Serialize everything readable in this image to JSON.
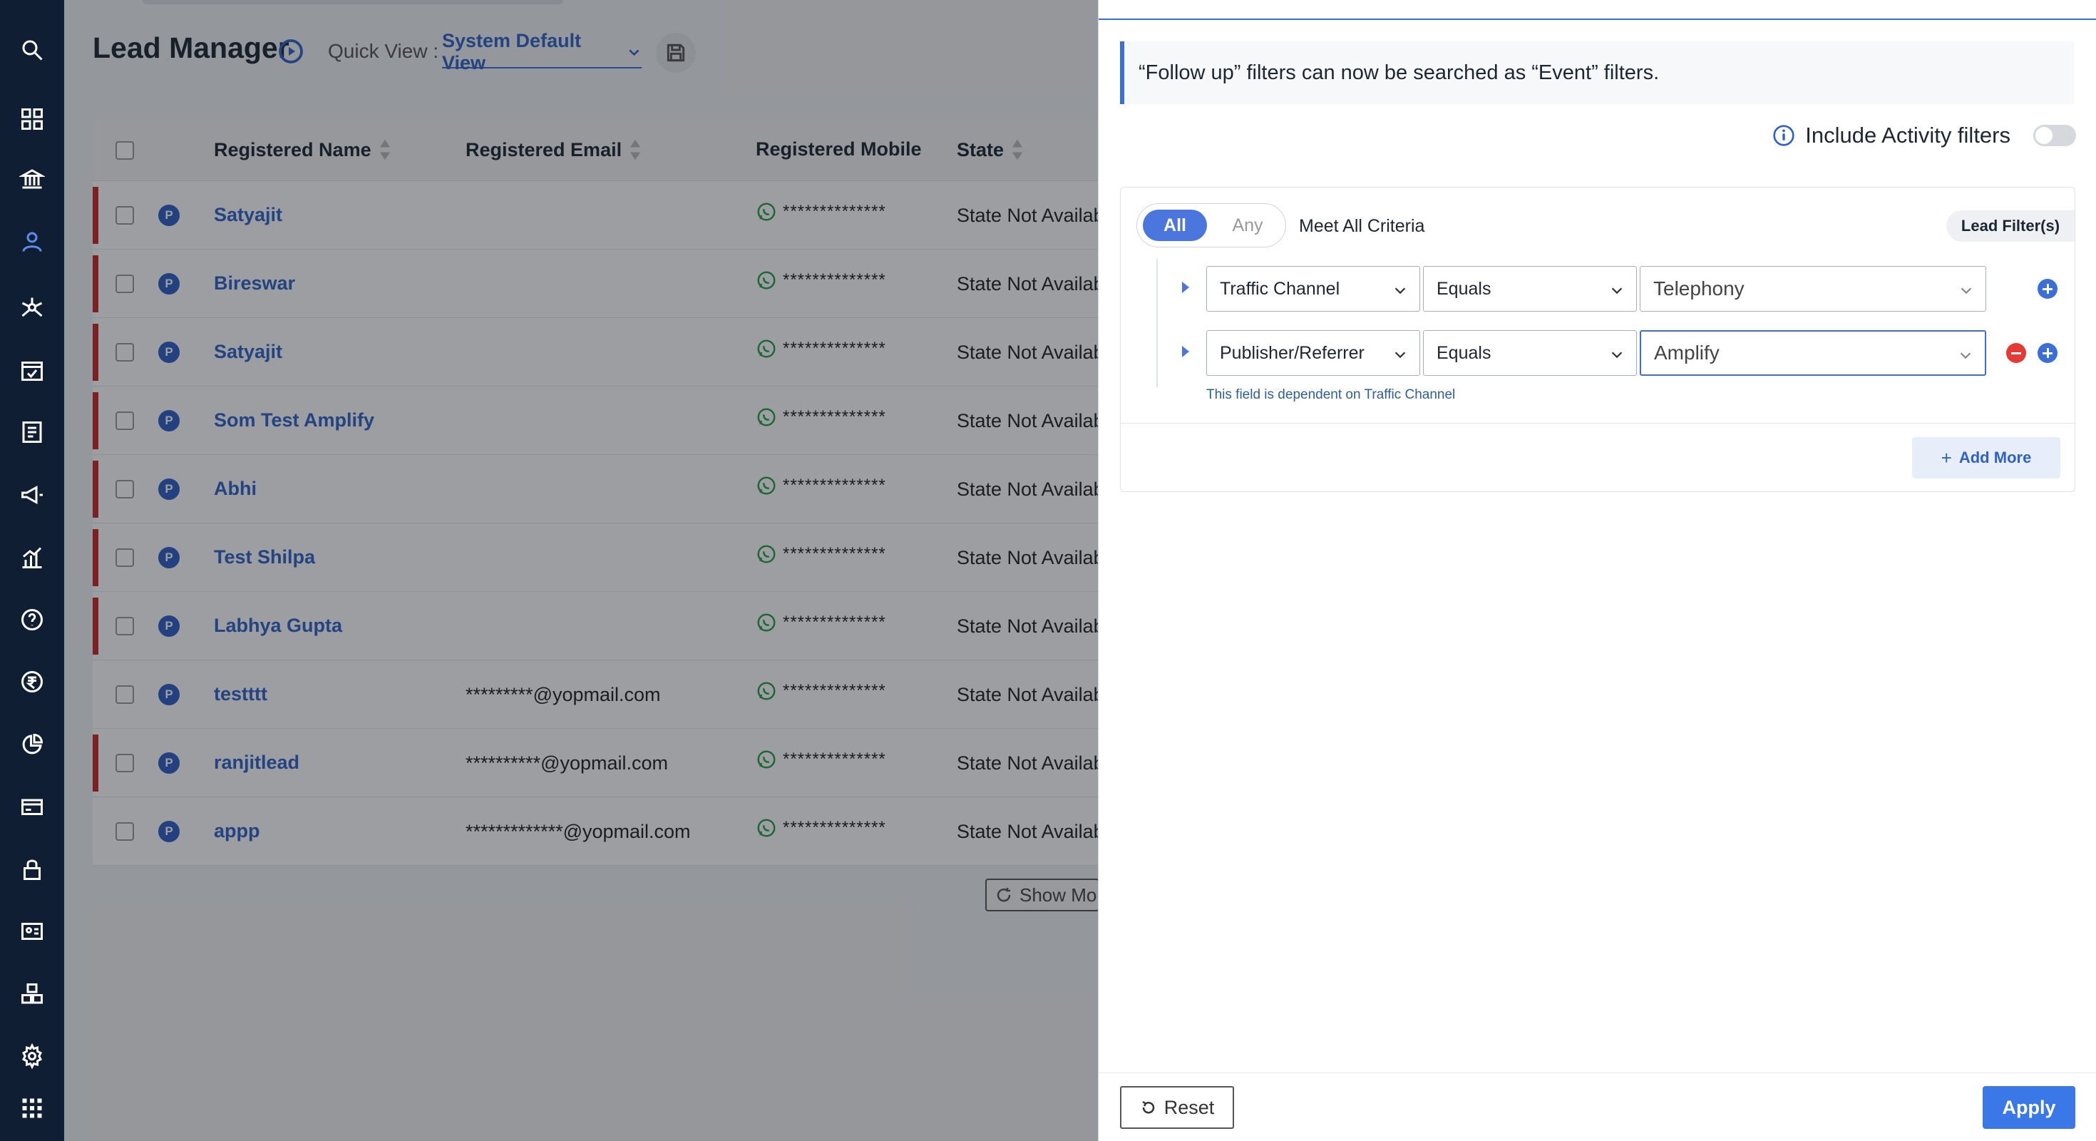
{
  "nav": {
    "icons": [
      "search-icon",
      "dashboard-icon",
      "bank-icon",
      "user-icon",
      "network-icon",
      "calendar-check-icon",
      "report-icon",
      "megaphone-icon",
      "analytics-icon",
      "help-icon",
      "rupee-icon",
      "pie-chart-icon",
      "card-icon",
      "lock-icon",
      "id-card-icon",
      "cubes-icon",
      "gear-icon",
      "apps-grid-icon"
    ],
    "active": "user-icon"
  },
  "header": {
    "title": "Lead Manager",
    "quick_view_label": "Quick View :",
    "quick_view_value": "System Default View"
  },
  "table": {
    "columns": [
      "Registered Name",
      "Registered Email",
      "Registered Mobile",
      "State"
    ],
    "rows": [
      {
        "name": "Satyajit",
        "email": "",
        "mobile": "**************",
        "state": "State Not Availab",
        "flagged": true
      },
      {
        "name": "Bireswar",
        "email": "",
        "mobile": "**************",
        "state": "State Not Availab",
        "flagged": true
      },
      {
        "name": "Satyajit",
        "email": "",
        "mobile": "**************",
        "state": "State Not Availab",
        "flagged": true
      },
      {
        "name": "Som Test Amplify",
        "email": "",
        "mobile": "**************",
        "state": "State Not Availab",
        "flagged": true
      },
      {
        "name": "Abhi",
        "email": "",
        "mobile": "**************",
        "state": "State Not Availab",
        "flagged": true
      },
      {
        "name": "Test Shilpa",
        "email": "",
        "mobile": "**************",
        "state": "State Not Availab",
        "flagged": true
      },
      {
        "name": "Labhya Gupta",
        "email": "",
        "mobile": "**************",
        "state": "State Not Availab",
        "flagged": true
      },
      {
        "name": "testttt",
        "email": "*********@yopmail.com",
        "mobile": "**************",
        "state": "State Not Availab",
        "flagged": false
      },
      {
        "name": "ranjitlead",
        "email": "**********@yopmail.com",
        "mobile": "**************",
        "state": "State Not Availab",
        "flagged": true
      },
      {
        "name": "appp",
        "email": "*************@yopmail.com",
        "mobile": "**************",
        "state": "State Not Availab",
        "flagged": false
      }
    ],
    "badge": "P",
    "show_more": "Show Mo"
  },
  "panel": {
    "notice": "“Follow up” filters can now be searched as “Event” filters.",
    "activity_label": "Include Activity filters",
    "toggle_on": false,
    "seg_all": "All",
    "seg_any": "Any",
    "meet_text": "Meet All Criteria",
    "lead_filters": "Lead Filter(s)",
    "filters": [
      {
        "field": "Traffic Channel",
        "operator": "Equals",
        "value": "Telephony"
      },
      {
        "field": "Publisher/Referrer",
        "operator": "Equals",
        "value": "Amplify"
      }
    ],
    "dependency_note": "This field is dependent on Traffic Channel",
    "add_more": "Add More",
    "reset": "Reset",
    "apply": "Apply"
  },
  "colors": {
    "accent": "#3b6fd8",
    "nav_bg": "#0f1e33",
    "flag": "#c62828",
    "remove": "#e53935"
  }
}
